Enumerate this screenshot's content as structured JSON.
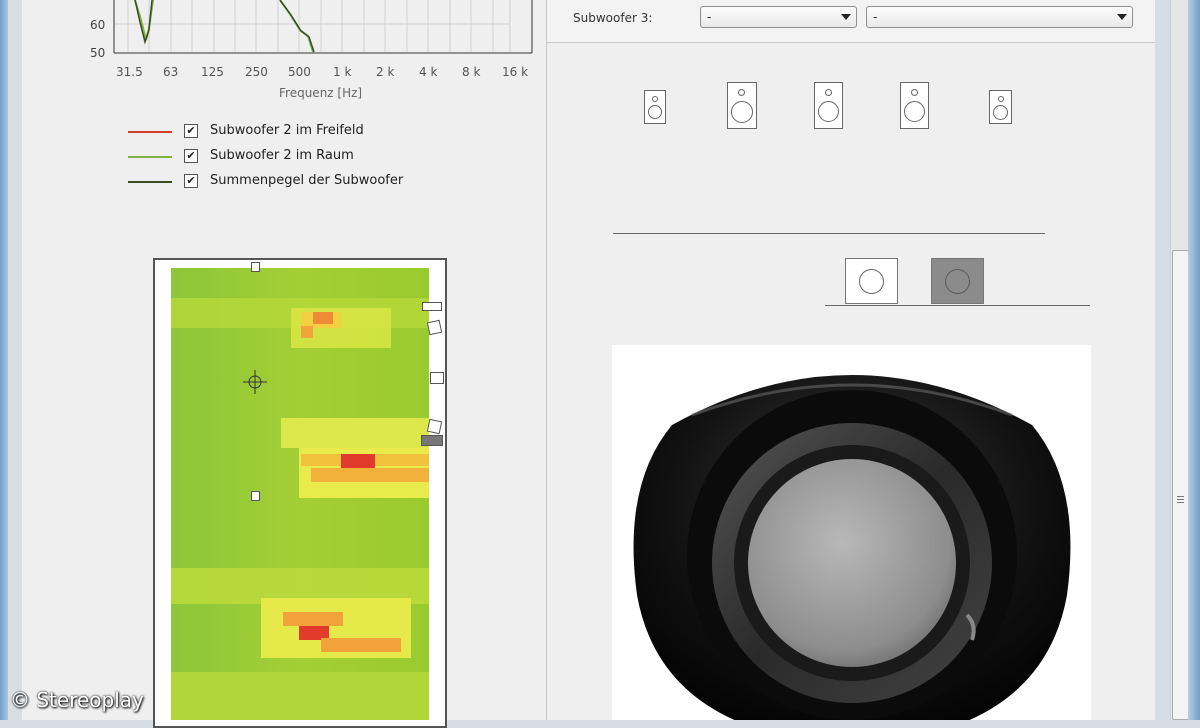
{
  "graph": {
    "y_ticks": [
      "60",
      "50"
    ],
    "x_ticks": [
      "31.5",
      "63",
      "125",
      "250",
      "500",
      "1 k",
      "2 k",
      "4 k",
      "8 k",
      "16 k"
    ],
    "x_axis_label": "Frequenz [Hz]"
  },
  "legend": [
    {
      "label": "Subwoofer 2 im Freifeld",
      "color": "#d23a2a",
      "checked": true
    },
    {
      "label": "Subwoofer 2 im Raum",
      "color": "#7cb342",
      "checked": true
    },
    {
      "label": "Summenpegel der Subwoofer",
      "color": "#3d4a25",
      "checked": true
    }
  ],
  "settings": {
    "subwoofer3_label": "Subwoofer 3:",
    "combo1_value": "-",
    "combo2_value": "-"
  },
  "heatmap": {
    "colors": {
      "low": "#9ccc2b",
      "mid": "#e8ea4a",
      "high": "#e23a2c"
    }
  },
  "watermark": "© Stereoplay"
}
